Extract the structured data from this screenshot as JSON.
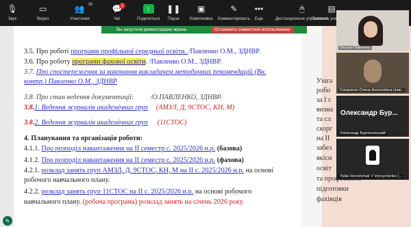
{
  "toolbar": {
    "audio_label": "Звук",
    "video_label": "Видео",
    "participants_label": "Участники",
    "participants_count": "18",
    "chat_label": "Чат",
    "chat_badge": "1",
    "share_label": "Поделиться",
    "pause_label": "Пауза",
    "annotate_label": "Компоновка",
    "comment_label": "Комментировать",
    "more_label": "Еще",
    "remote_label": "Дистанционное управление",
    "show_label": "Показать участников"
  },
  "banner": {
    "text": "Вы запустили демонстрацию экрана",
    "stop": "Остановить совместное использование"
  },
  "doc": {
    "l1_pre": "3.5. Про роботі ",
    "l1_link": "програми профільної середньої освіти. ",
    "l1_post": "/Павленко О.М., ЗДНВР.",
    "l2_pre": "3.6. Про роботу ",
    "l2_link": "програми фахової освіти",
    "l2_post": ".   /Павленко О.М., ЗДНВР.",
    "l3_pre": "3.7. ",
    "l3_link": "Про спостереження за виконання викладачем методичних рекомендацій (Вн.",
    "l4": "контр.) Павленко О.М., ЗДНВР",
    "l5_a": "3.8.       Про      стан      ведення      документації:",
    "l5_b": "/О.ПАВЛЕНКО,       ЗДНВР.",
    "l6_num": "3.8.",
    "l6_link": "1. Ведення журналів академічних груп",
    "l6_groups": "(АМЗЛ, Д, 9СТОС, КН, М)",
    "l7_num": "3.8.",
    "l7_link": "2. Ведення журналів академічних груп",
    "l7_groups": "(11СТОС)",
    "section4": "4. Планування та організація роботи:",
    "l411_pre": "4.1.1. ",
    "l411_link": "Про розподіл навантаження на ІІ семестр с.  2025/2026 н.р.",
    "l411_post": " (базова)",
    "l412_pre": "4.1.2. ",
    "l412_link": "Про розподіл навантаження на ІІ семестр с.  2025/2026 н.р.",
    "l412_post": " (фахова)",
    "l421_pre": "4.2.1. ",
    "l421_link": "розклад занять груп АМЗЛ, Д, 9СТОС, КН, М на ІІ с.  2025/2026 н.р.",
    "l421_post": " на основі",
    "l421_cont": "робочого навчального плану.",
    "l422_pre": "4.2.2. ",
    "l422_link": "розклад занять груп 11СТОС на ІІ с.  2025/2026 н.р.",
    "l422_post": " на основі робочого",
    "l422_cont": "навчального плану. ",
    "l422_red": "(робоча програма) ",
    "l422_red2": "розклад занять на січень 2026 року."
  },
  "right_text": [
    "Узага",
    "робо",
    "за  І с",
    "визна",
    "та сл",
    "скорг",
    "на ІІ",
    "забез",
    "якісн",
    "освіт",
    "та професійної",
    "підготовки",
    "фахівців"
  ],
  "participants": [
    {
      "name": "Оксана Павленко"
    },
    {
      "name": "Сокуренко Олена Анатоліївна (заві..."
    },
    {
      "name": "Олександр Бургяновський",
      "display": "Олександр  Бур..."
    },
    {
      "name": "Yuliia Vereshchak V Vynnychenko (..."
    }
  ]
}
